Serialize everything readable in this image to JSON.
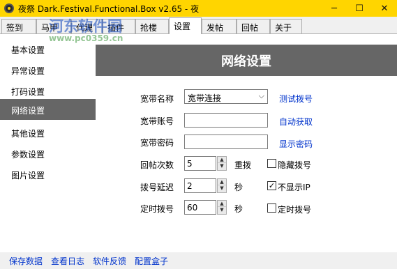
{
  "window": {
    "title": "夜祭 Dark.Festival.Functional.Box v2.65 - 夜",
    "minimize": "─",
    "maximize": "☐",
    "close": "✕",
    "accent_color": "#ffd500"
  },
  "watermark": {
    "text": "河东软件园",
    "url": "www.pc0359.cn"
  },
  "tabs": [
    {
      "label": "签到"
    },
    {
      "label": "马甲"
    },
    {
      "label": "代理"
    },
    {
      "label": "插件"
    },
    {
      "label": "抢楼"
    },
    {
      "label": "设置",
      "active": true
    },
    {
      "label": "发帖"
    },
    {
      "label": "回帖"
    },
    {
      "label": "关于"
    }
  ],
  "sidebar": {
    "items": [
      {
        "label": "基本设置"
      },
      {
        "label": "异常设置"
      },
      {
        "label": "打码设置"
      },
      {
        "label": "网络设置",
        "active": true
      },
      {
        "label": "其他设置"
      },
      {
        "label": "参数设置"
      },
      {
        "label": "图片设置"
      }
    ]
  },
  "content": {
    "title": "网络设置",
    "broadband_name": {
      "label": "宽带名称",
      "value": "宽带连接",
      "link": "测试拨号"
    },
    "broadband_account": {
      "label": "宽带账号",
      "value": "",
      "link": "自动获取"
    },
    "broadband_password": {
      "label": "宽带密码",
      "value": "",
      "link": "显示密码"
    },
    "reply_count": {
      "label": "回帖次数",
      "value": "5",
      "unit": "重拨",
      "checkbox_label": "隐藏拨号",
      "checked": false
    },
    "dial_delay": {
      "label": "拨号延迟",
      "value": "2",
      "unit": "秒",
      "checkbox_label": "不显示IP",
      "checked": true
    },
    "timed_dial": {
      "label": "定时拨号",
      "value": "60",
      "unit": "秒",
      "checkbox_label": "定时拨号",
      "checked": false
    }
  },
  "bottom_links": [
    {
      "label": "保存数据"
    },
    {
      "label": "查看日志"
    },
    {
      "label": "软件反馈"
    },
    {
      "label": "配置盒子"
    }
  ]
}
